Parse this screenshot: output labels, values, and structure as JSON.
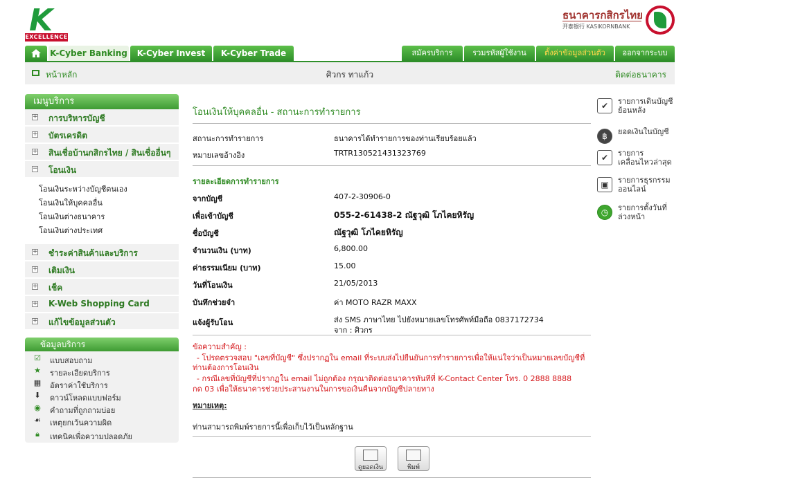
{
  "header": {
    "logo_k": "K",
    "logo_excellence": "EXCELLENCE",
    "bank_name_th": "ธนาคารกสิกรไทย",
    "bank_name_en": "开泰银行 KASIKORNBANK"
  },
  "nav": {
    "tabs": [
      "K-Cyber Banking",
      "K-Cyber Invest",
      "K-Cyber Trade"
    ],
    "right_tabs": [
      "สมัครบริการ",
      "รวมรหัสผู้ใช้งาน",
      "ตั้งค่าข้อมูลส่วนตัว",
      "ออกจากระบบ"
    ]
  },
  "subbar": {
    "home": "หน้าหลัก",
    "user": "ศิวกร ทาแก้ว",
    "contact": "ติดต่อธนาคาร"
  },
  "sidebar": {
    "menu_title": "เมนูบริการ",
    "items": [
      {
        "label": "การบริหารบัญชี",
        "sign": "+"
      },
      {
        "label": "บัตรเครดิต",
        "sign": "+"
      },
      {
        "label": "สินเชื่อบ้านกสิกรไทย / สินเชื่ออื่นๆ",
        "sign": "+"
      },
      {
        "label": "โอนเงิน",
        "sign": "−"
      }
    ],
    "subitems": [
      "โอนเงินระหว่างบัญชีตนเอง",
      "โอนเงินให้บุคคลอื่น",
      "โอนเงินต่างธนาคาร",
      "โอนเงินต่างประเทศ"
    ],
    "items2": [
      {
        "label": "ชำระค่าสินค้าและบริการ",
        "sign": "+"
      },
      {
        "label": "เติมเงิน",
        "sign": "+"
      },
      {
        "label": "เช็ค",
        "sign": "+"
      },
      {
        "label": "K-Web Shopping Card",
        "sign": "+"
      },
      {
        "label": "แก้ไขข้อมูลส่วนตัว",
        "sign": "+"
      }
    ],
    "info_title": "ข้อมูลบริการ",
    "info_items": [
      "แบบสอบถาม",
      "รายละเอียดบริการ",
      "อัตราค่าใช้บริการ",
      "ดาวน์โหลดแบบฟอร์ม",
      "คำถามที่ถูกถามบ่อย",
      "เหตุยกเว้นความผิด",
      "เทคนิคเพื่อความปลอดภัย"
    ]
  },
  "main": {
    "title": "โอนเงินให้บุคคลอื่น - สถานะการทำรายการ",
    "status_label": "สถานะการทำรายการ",
    "status_value": "ธนาคารได้ทำรายการของท่านเรียบร้อยแล้ว",
    "ref_label": "หมายเลขอ้างอิง",
    "ref_value": "TRTR130521431323769",
    "detail_title": "รายละเอียดการทำรายการ",
    "from_label": "จากบัญชี",
    "from_value": "407-2-30906-0",
    "to_label": "เพื่อเข้าบัญชี",
    "to_value": "055-2-61438-2 ณัฐวุฒิ โภไคยหิรัญ",
    "name_label": "ชื่อบัญชี",
    "name_value": "ณัฐวุฒิ โภไคยหิรัญ",
    "amount_label": "จำนวนเงิน (บาท)",
    "amount_value": "6,800.00",
    "fee_label": "ค่าธรรมเนียม (บาท)",
    "fee_value": "15.00",
    "date_label": "วันที่โอนเงิน",
    "date_value": "21/05/2013",
    "memo_label": "บันทึกช่วยจำ",
    "memo_value": "ค่า MOTO RAZR MAXX",
    "notify_label": "แจ้งผู้รับโอน",
    "notify_value_1": "ส่ง SMS ภาษาไทย ไปยังหมายเลขโทรศัพท์มือถือ 0837172734",
    "notify_value_2": "จาก : ศิวกร",
    "important_title": "ข้อความสำคัญ :",
    "important_1a": "- โปรดตรวจสอบ \"เลขที่บัญชี\" ซึ่งปรากฏใน email ที่ระบบส่งไปยืนยันการทำรายการเพื่อให้แน่ใจว่าเป็นหมายเลขบัญชีที่",
    "important_1b": "ท่านต้องการโอนเงิน",
    "important_2a": "- กรณีเลขที่บัญชีที่ปรากฏใน email ไม่ถูกต้อง กรุณาติดต่อธนาคารทันทีที่ K-Contact Center โทร. 0 2888 8888",
    "important_2b": "กด 03 เพื่อให้ธนาคารช่วยประสานงานในการขอเงินคืนจากบัญชีปลายทาง",
    "note_title": "หมายเหตุ:",
    "note_text": "ท่านสามารถพิมพ์รายการนี้เพื่อเก็บไว้เป็นหลักฐาน",
    "btn_view": "ดูยอดเงิน",
    "btn_print": "พิมพ์"
  },
  "quicklinks": [
    {
      "text": "รายการเดินบัญชีย้อนหลัง",
      "icon": "statement-icon"
    },
    {
      "text": "ยอดเงินในบัญชี",
      "icon": "money-bag-icon"
    },
    {
      "text": "รายการเคลื่อนไหวล่าสุด",
      "icon": "recent-icon"
    },
    {
      "text": "รายการธุรกรรมออนไลน์",
      "icon": "online-icon"
    },
    {
      "text": "รายการตั้งวันที่ล่วงหน้า",
      "icon": "clock-icon"
    }
  ]
}
